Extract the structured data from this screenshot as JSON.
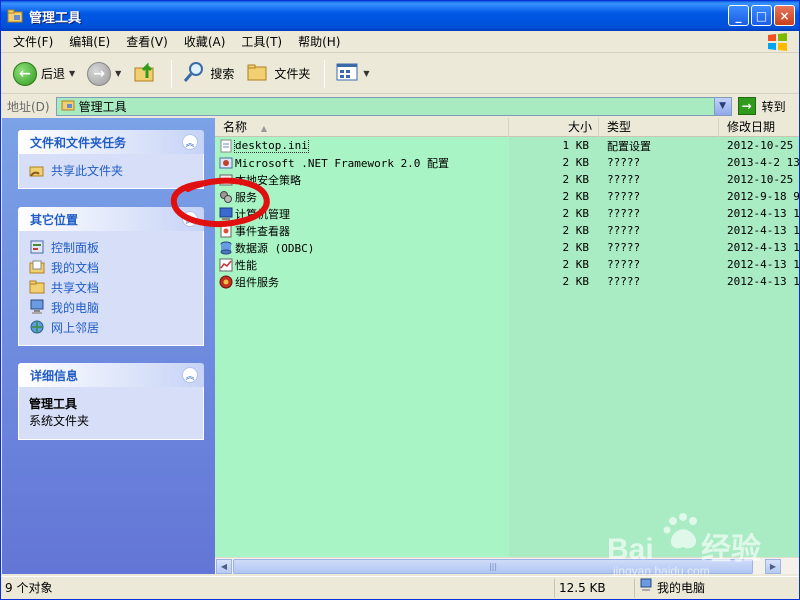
{
  "window": {
    "title": "管理工具",
    "buttons": {
      "minimize": "_",
      "maximize": "□",
      "close": "×"
    }
  },
  "menu": [
    "文件(F)",
    "编辑(E)",
    "查看(V)",
    "收藏(A)",
    "工具(T)",
    "帮助(H)"
  ],
  "toolbar": {
    "back": "后退",
    "search": "搜索",
    "folders": "文件夹"
  },
  "address": {
    "label": "地址(D)",
    "value": "管理工具",
    "go": "转到"
  },
  "tasks": {
    "file_tasks": {
      "title": "文件和文件夹任务",
      "items": [
        "共享此文件夹"
      ]
    },
    "other_places": {
      "title": "其它位置",
      "items": [
        "控制面板",
        "我的文档",
        "共享文档",
        "我的电脑",
        "网上邻居"
      ]
    },
    "details": {
      "title": "详细信息",
      "name": "管理工具",
      "type": "系统文件夹"
    }
  },
  "columns": {
    "name": "名称",
    "size": "大小",
    "type": "类型",
    "date": "修改日期"
  },
  "files": [
    {
      "name": "desktop.ini",
      "size": "1 KB",
      "type": "配置设置",
      "date": "2012-10-25",
      "icon": "ini-file-icon"
    },
    {
      "name": "Microsoft .NET Framework 2.0 配置",
      "size": "2 KB",
      "type": "?????",
      "date": "2013-4-2 13",
      "icon": "net-config-icon"
    },
    {
      "name": "本地安全策略",
      "size": "2 KB",
      "type": "?????",
      "date": "2012-10-25",
      "icon": "security-policy-icon"
    },
    {
      "name": "服务",
      "size": "2 KB",
      "type": "?????",
      "date": "2012-9-18 9",
      "icon": "services-icon"
    },
    {
      "name": "计算机管理",
      "size": "2 KB",
      "type": "?????",
      "date": "2012-4-13 1",
      "icon": "computer-management-icon"
    },
    {
      "name": "事件查看器",
      "size": "2 KB",
      "type": "?????",
      "date": "2012-4-13 1",
      "icon": "event-viewer-icon"
    },
    {
      "name": "数据源 (ODBC)",
      "size": "2 KB",
      "type": "?????",
      "date": "2012-4-13 1",
      "icon": "odbc-icon"
    },
    {
      "name": "性能",
      "size": "2 KB",
      "type": "?????",
      "date": "2012-4-13 1",
      "icon": "performance-icon"
    },
    {
      "name": "组件服务",
      "size": "2 KB",
      "type": "?????",
      "date": "2012-4-13 1",
      "icon": "component-services-icon"
    }
  ],
  "status": {
    "count": "9 个对象",
    "size": "12.5 KB",
    "location": "我的电脑"
  },
  "colors": {
    "list_bg": "#a9ebc3",
    "title_blue": "#0058e6",
    "link_blue": "#215dc6",
    "annotation_red": "#e01010"
  }
}
